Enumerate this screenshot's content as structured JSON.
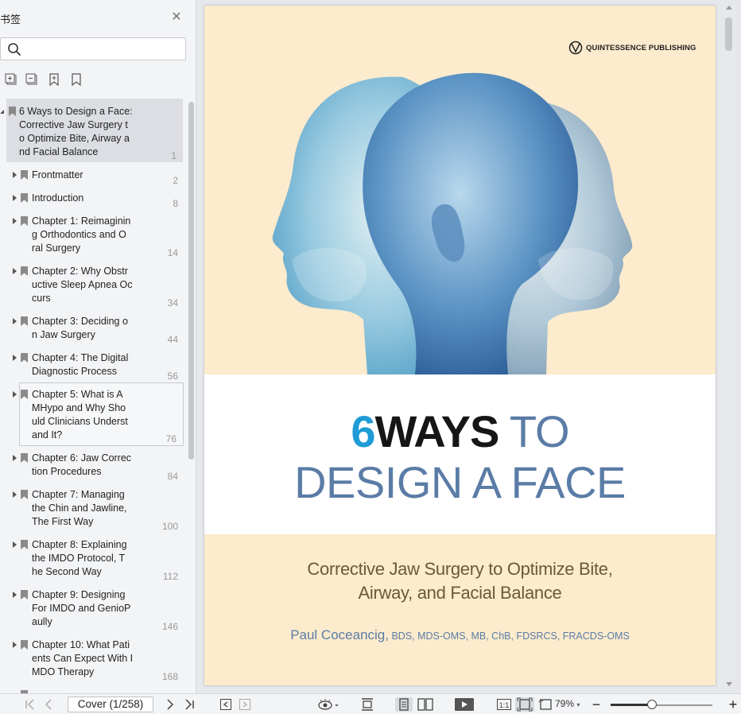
{
  "sidebar": {
    "title": "书签",
    "search": {
      "value": "",
      "placeholder": ""
    },
    "tools": [
      "expand-all-icon",
      "collapse-all-icon",
      "add-bookmark-icon",
      "bookmark-icon"
    ],
    "bookmarks": [
      {
        "label": "6 Ways to Design a Face:\nCorrective Jaw Surgery t\no Optimize Bite, Airway a\nnd Facial Balance",
        "page": "1"
      },
      {
        "label": "Frontmatter",
        "page": "2"
      },
      {
        "label": "Introduction",
        "page": "8"
      },
      {
        "label": "Chapter 1: Reimaginin\ng Orthodontics and O\nral Surgery",
        "page": "14"
      },
      {
        "label": "Chapter 2: Why Obstr\nuctive Sleep Apnea Oc\ncurs",
        "page": "34"
      },
      {
        "label": "Chapter 3: Deciding o\nn Jaw Surgery",
        "page": "44"
      },
      {
        "label": "Chapter 4: The Digital\nDiagnostic Process",
        "page": "56"
      },
      {
        "label": "Chapter 5: What is A\nMHypo and Why Sho\nuld Clinicians Underst\nand It?",
        "page": "76"
      },
      {
        "label": "Chapter 6: Jaw Correc\ntion Procedures",
        "page": "84"
      },
      {
        "label": "Chapter 7: Managing\nthe Chin and Jawline,\nThe First Way",
        "page": "100"
      },
      {
        "label": "Chapter 8: Explaining\nthe IMDO Protocol, T\nhe Second Way",
        "page": "112"
      },
      {
        "label": "Chapter 9: Designing\nFor IMDO and GenioP\naully",
        "page": "146"
      },
      {
        "label": "Chapter 10: What Pati\nents Can Expect With I\nMDO Therapy",
        "page": "168"
      }
    ]
  },
  "cover": {
    "publisher": "QUINTESSENCE PUBLISHING",
    "title_six": "6",
    "title_ways": "WAYS",
    "title_to": " TO",
    "title_line2": "DESIGN A FACE",
    "subtitle_line1": "Corrective Jaw Surgery to Optimize Bite,",
    "subtitle_line2": "Airway, and Facial Balance",
    "author_name": "Paul Coceancig,",
    "author_creds": " BDS, MDS-OMS, MB, ChB, FDSRCS, FRACDS-OMS"
  },
  "bottombar": {
    "page_display": "Cover (1/258)",
    "zoom": "79%",
    "zoom_fraction": 0.41
  }
}
